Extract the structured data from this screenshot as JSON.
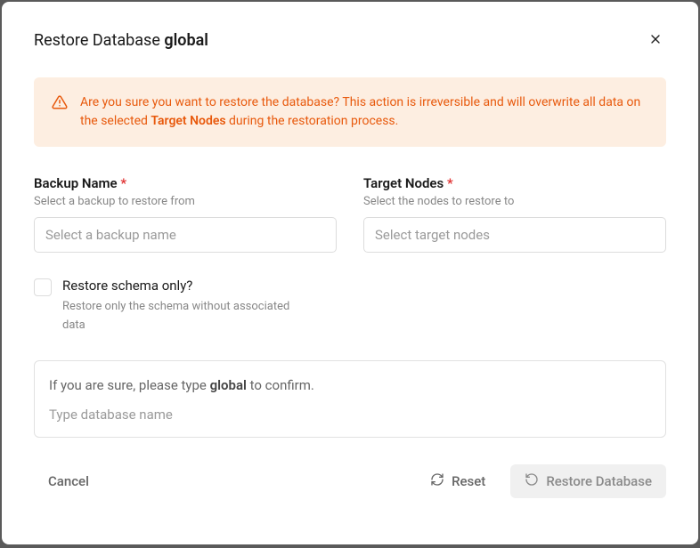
{
  "header": {
    "title_prefix": "Restore Database ",
    "title_db_name": "global"
  },
  "warning": {
    "text_before": "Are you sure you want to restore the database? This action is irreversible and will overwrite all data on the selected ",
    "text_strong": "Target Nodes",
    "text_after": " during the restoration process."
  },
  "form": {
    "backup_name": {
      "label": "Backup Name ",
      "hint": "Select a backup to restore from",
      "placeholder": "Select a backup name"
    },
    "target_nodes": {
      "label": "Target Nodes ",
      "hint": "Select the nodes to restore to",
      "placeholder": "Select target nodes"
    },
    "schema_only": {
      "label": "Restore schema only?",
      "hint": "Restore only the schema without associated data"
    }
  },
  "confirm": {
    "text_before": "If you are sure, please type ",
    "text_strong": "global",
    "text_after": " to confirm.",
    "placeholder": "Type database name"
  },
  "footer": {
    "cancel": "Cancel",
    "reset": "Reset",
    "submit": "Restore Database"
  },
  "required_marker": "*"
}
